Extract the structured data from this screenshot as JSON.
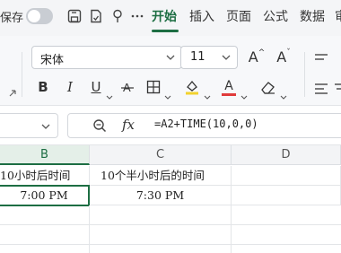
{
  "quick_access": {
    "autosave_label": "保存",
    "autosave_on": false
  },
  "tabs": [
    {
      "label": "开始",
      "active": true
    },
    {
      "label": "插入",
      "active": false
    },
    {
      "label": "页面",
      "active": false
    },
    {
      "label": "公式",
      "active": false
    },
    {
      "label": "数据",
      "active": false
    },
    {
      "label": "审",
      "active": false
    }
  ],
  "ribbon": {
    "font_name": "宋体",
    "font_size": "11",
    "grow_font_label": "A",
    "shrink_font_label": "A",
    "bold_label": "B",
    "italic_label": "I",
    "underline_label": "U",
    "font_color_label": "A",
    "highlight_color": "#f2d22e",
    "font_color": "#e03b3b"
  },
  "formula_bar": {
    "name_box": "",
    "fx_label": "fx",
    "formula": "=A2+TIME(10,0,0)"
  },
  "sheet": {
    "columns": [
      "B",
      "C",
      "D"
    ],
    "selected_column": "B",
    "rows": [
      {
        "B": "10小时后时间",
        "C": "10个半小时后的时间",
        "D": ""
      },
      {
        "B": "7:00 PM",
        "C": "7:30 PM",
        "D": ""
      }
    ]
  },
  "colors": {
    "accent": "#1d6e43"
  }
}
